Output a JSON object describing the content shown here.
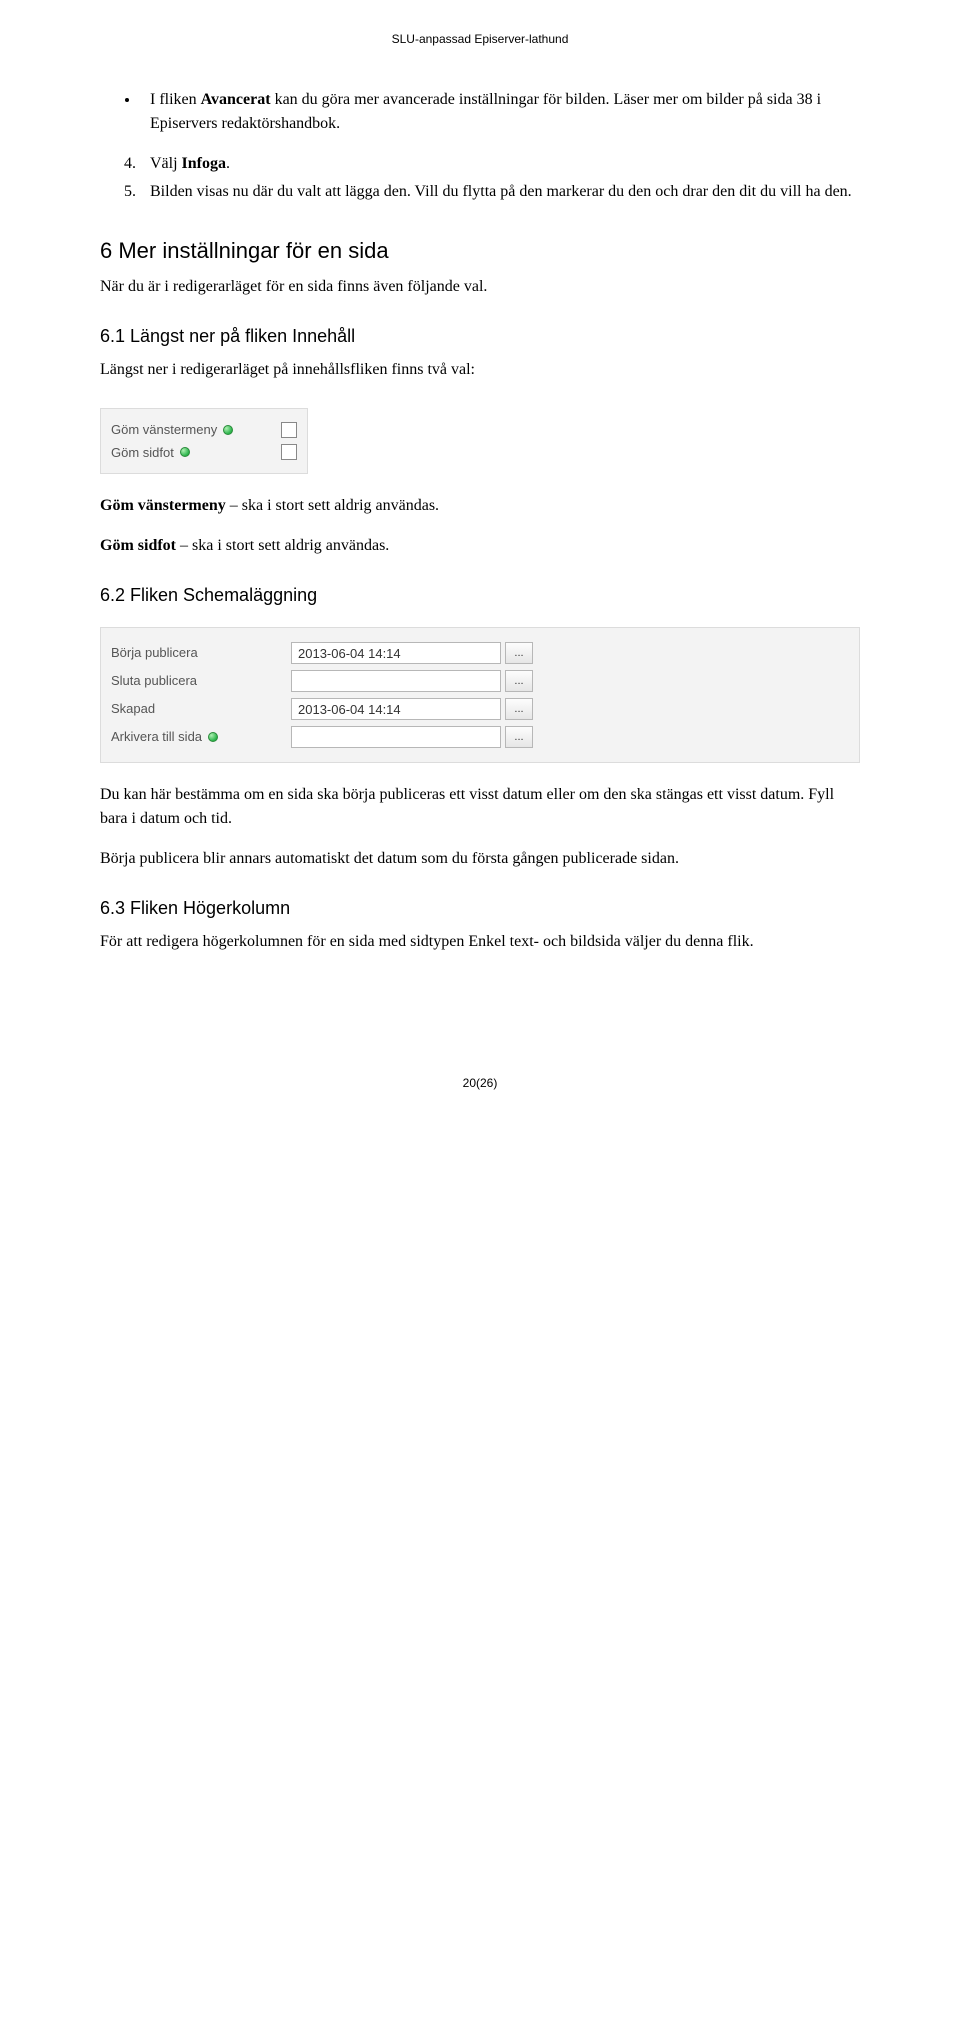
{
  "header": {
    "text": "SLU-anpassad Episerver-lathund"
  },
  "bullet1": {
    "line1_pre": "I fliken ",
    "line1_bold": "Avancerat",
    "line1_post": " kan du göra mer avancerade inställningar för bilden. Läser mer om bilder på sida 38 i Episervers redaktörshandbok."
  },
  "numlist": {
    "item4_pre": "Välj ",
    "item4_bold": "Infoga",
    "item4_post": ".",
    "item5": "Bilden visas nu där du valt att lägga den. Vill du flytta på den markerar du den och drar den dit du vill ha den."
  },
  "section6": {
    "heading": "6   Mer inställningar för en sida",
    "intro": "När du är i redigerarläget för en sida finns även följande val.",
    "sub61_heading": "6.1 Längst ner på fliken Innehåll",
    "sub61_intro": "Längst ner i redigerarläget på innehållsfliken finns två val:",
    "row1_label": "Göm vänstermeny",
    "row2_label": "Göm sidfot",
    "p_vanster_bold": "Göm vänstermeny",
    "p_vanster_rest": " – ska i stort sett aldrig användas.",
    "p_sidfot_bold": "Göm sidfot",
    "p_sidfot_rest": " – ska i stort sett aldrig användas.",
    "sub62_heading": "6.2 Fliken Schemaläggning",
    "sched_row1_label": "Börja publicera",
    "sched_row1_value": "2013-06-04 14:14",
    "sched_row2_label": "Sluta publicera",
    "sched_row2_value": "",
    "sched_row3_label": "Skapad",
    "sched_row3_value": "2013-06-04 14:14",
    "sched_row4_label": "Arkivera till sida",
    "sched_row4_value": "",
    "btn_ellipsis": "...",
    "p_sched1": "Du kan här bestämma om en sida ska börja publiceras ett visst datum eller om den ska stängas ett visst datum. Fyll bara i datum och tid.",
    "p_sched2": "Börja publicera blir annars automatiskt det datum som du första gången publicerade sidan.",
    "sub63_heading": "6.3 Fliken Högerkolumn",
    "p_63": "För att redigera högerkolumnen för en sida med sidtypen Enkel text- och bildsida väljer du denna flik."
  },
  "footer": {
    "page": "20(26)"
  }
}
